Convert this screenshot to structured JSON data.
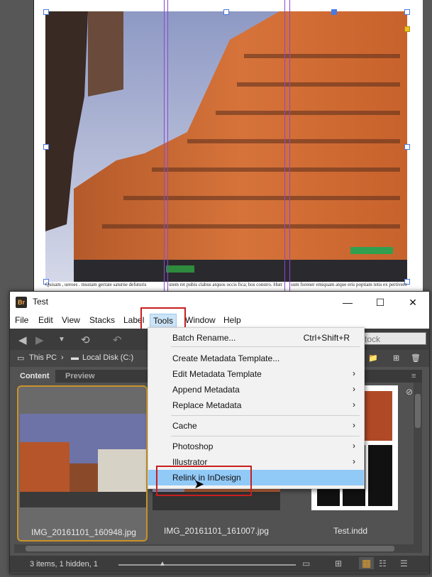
{
  "indesign": {
    "text_left": "Quisam , ueroes . mustam gerrate saturne defuturis",
    "text_mid": "utem ret pubis clabus atquos occis fica; hos constro. Hum interibi perceptil",
    "text_right": "sum forener emiquam atque eris poptiam tetis ex pertiverente mandibil tetere insspercam in mercatiscer"
  },
  "bridge": {
    "title": "Test",
    "app_logo": "Br",
    "window_controls": {
      "minimize": "—",
      "maximize": "☐",
      "close": "✕"
    },
    "menu": [
      "File",
      "Edit",
      "View",
      "Stacks",
      "Label",
      "Tools",
      "Window",
      "Help"
    ],
    "search_placeholder": "tock",
    "breadcrumb": [
      "This PC",
      "Local Disk (C:)"
    ],
    "tabs": [
      "Content",
      "Preview"
    ],
    "thumbnails": [
      {
        "name": "IMG_20161101_160948.jpg",
        "selected": true
      },
      {
        "name": "IMG_20161101_161007.jpg",
        "selected": false
      },
      {
        "name": "Test.indd",
        "selected": false
      }
    ],
    "status": "3 items, 1 hidden, 1"
  },
  "tools_menu": {
    "items": [
      {
        "label": "Batch Rename...",
        "shortcut": "Ctrl+Shift+R",
        "submenu": false
      },
      {
        "label": "Create Metadata Template...",
        "shortcut": "",
        "submenu": false
      },
      {
        "label": "Edit Metadata Template",
        "shortcut": "",
        "submenu": true
      },
      {
        "label": "Append Metadata",
        "shortcut": "",
        "submenu": true
      },
      {
        "label": "Replace Metadata",
        "shortcut": "",
        "submenu": true
      },
      {
        "label": "Cache",
        "shortcut": "",
        "submenu": true
      },
      {
        "label": "Photoshop",
        "shortcut": "",
        "submenu": true
      },
      {
        "label": "Illustrator",
        "shortcut": "",
        "submenu": true
      },
      {
        "label": "Relink in InDesign",
        "shortcut": "",
        "submenu": false,
        "highlighted": true
      }
    ]
  },
  "colors": {
    "highlight_box": "#c81e1e",
    "menu_hover": "#91c9f7",
    "selected_thumb": "#c8922a"
  }
}
